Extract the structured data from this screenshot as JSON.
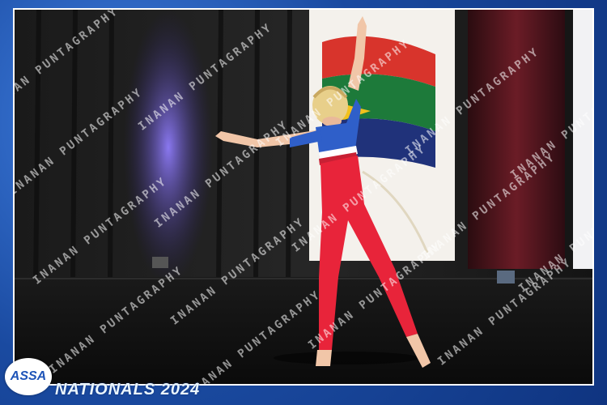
{
  "photo": {
    "watermark_text": "INANAN PUNTAGRAPHY",
    "logo_text": "ASSA",
    "event_title": "NATIONALS 2024"
  },
  "colors": {
    "frame_blue": "#1d4fa8",
    "leotard_red": "#e8243a",
    "leotard_blue": "#2f5fc9",
    "stage_dark": "#121212",
    "curtain_maroon": "#5a1620",
    "light_purple": "#6a5ad8"
  }
}
